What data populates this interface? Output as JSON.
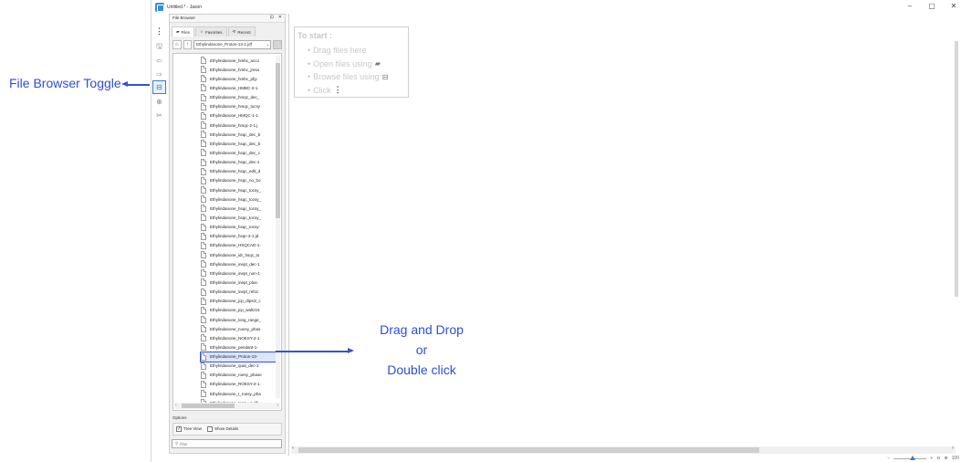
{
  "window": {
    "title": "Untitled.* - Jason",
    "controls": [
      "–",
      "▢",
      "✕"
    ]
  },
  "toolbar": {
    "items": [
      "more-icon",
      "save-icon",
      "undo-icon",
      "redo-icon",
      "file-browser-icon",
      "zoom-icon",
      "tools-icon"
    ]
  },
  "file_browser": {
    "title": "File Browser",
    "header_buttons": [
      "⊡",
      "✕"
    ],
    "tabs": [
      {
        "label": "Files",
        "icon": "▰"
      },
      {
        "label": "Favorites",
        "icon": "☆"
      },
      {
        "label": "Recent",
        "icon": "⟲"
      }
    ],
    "path": "Ethylindanone_Proton-13-1.jdf",
    "files": [
      "Ethylindanone_hmbc_acco",
      "Ethylindanone_hmbc_jreso",
      "Ethylindanone_hmbc_pfg-",
      "Ethylindanone_HMBC-2-1.",
      "Ethylindanone_hmqc_dec_",
      "Ethylindanone_hmqc_tocsy",
      "Ethylindanone_HMQC-1-1.",
      "Ethylindanone_hmqc-2-1.j",
      "Ethylindanone_hsqc_dec_b",
      "Ethylindanone_hsqc_dec_b",
      "Ethylindanone_hsqc_dec_c",
      "Ethylindanone_hsqc_dec-1",
      "Ethylindanone_hsqc_edit_d",
      "Ethylindanone_hsqc_no_bo",
      "Ethylindanone_hsqc_tocsy_",
      "Ethylindanone_hsqc_tocsy_",
      "Ethylindanone_hsqc_tocsy_",
      "Ethylindanone_hsqc_tocsy_",
      "Ethylindanone_hsqc_tocsy-",
      "Ethylindanone_hsqc-2-1.jd",
      "Ethylindanone_HSQCAD-1-",
      "Ethylindanone_idr_hsqc_to",
      "Ethylindanone_inept_dec-1",
      "Ethylindanone_inept_non-1",
      "Ethylindanone_inept_plus-",
      "Ethylindanone_inept_refoc",
      "Ethylindanone_jcp_dipsi2_c",
      "Ethylindanone_jcp_waltz16",
      "Ethylindanone_long_range_",
      "Ethylindanone_noesy_phas",
      "Ethylindanone_NOESY-2-1.",
      "Ethylindanone_pendant-1-",
      "Ethylindanone_Proton-13-",
      "Ethylindanone_quat_dec-1",
      "Ethylindanone_roesy_phase",
      "Ethylindanone_ROESY-2-1.",
      "Ethylindanone_t_roesy_pha",
      "Ethylindanone_tocsy_1.jdf"
    ],
    "selected_index": 32,
    "options": {
      "title": "Options",
      "tree_view": {
        "label": "Tree View",
        "checked": true
      },
      "show_details": {
        "label": "Show Details",
        "checked": false
      }
    },
    "filter_placeholder": "filter"
  },
  "start_panel": {
    "title": "To start :",
    "items": [
      "Drag files here",
      "Open files using",
      "Browse files using",
      "Click"
    ]
  },
  "annotations": {
    "file_browser_toggle": "File Browser Toggle",
    "drag_drop": [
      "Drag and Drop",
      "or",
      "Double click"
    ]
  },
  "status": {
    "zoom": "100"
  },
  "colors": {
    "annotation": "#2e4fd2",
    "accent": "#3a7bd5"
  }
}
